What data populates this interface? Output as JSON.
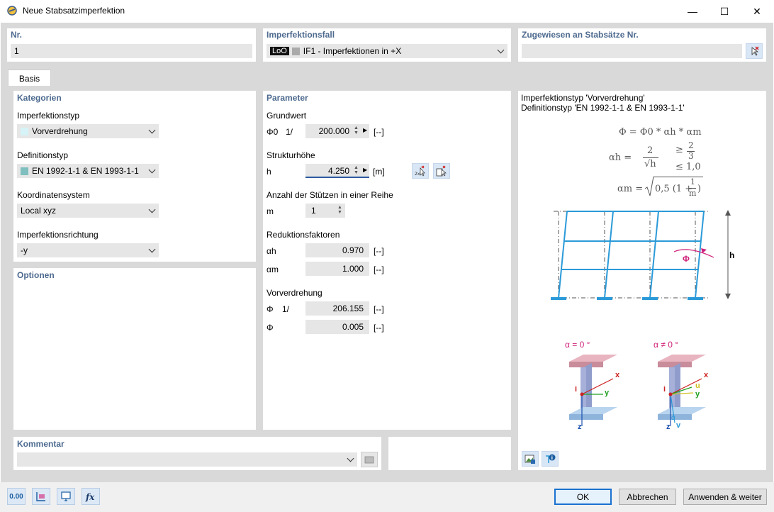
{
  "window": {
    "title": "Neue Stabsatzimperfektion",
    "minimize": "—",
    "maximize": "☐",
    "close": "✕"
  },
  "header": {
    "nr_label": "Nr.",
    "nr_value": "1",
    "case_label": "Imperfektionsfall",
    "case_badge": "LoO",
    "case_value": "IF1 - Imperfektionen in +X",
    "assigned_label": "Zugewiesen an Stabsätze Nr.",
    "assigned_value": ""
  },
  "tabs": [
    {
      "label": "Basis"
    }
  ],
  "categories": {
    "title": "Kategorien",
    "imperfection_type_label": "Imperfektionstyp",
    "imperfection_type_value": "Vorverdrehung",
    "imperfection_type_color": "#d6f3f7",
    "definition_type_label": "Definitionstyp",
    "definition_type_value": "EN 1992-1-1 & EN 1993-1-1",
    "definition_type_color": "#7fbfbf",
    "coord_label": "Koordinatensystem",
    "coord_value": "Local xyz",
    "direction_label": "Imperfektionsrichtung",
    "direction_value": "-y"
  },
  "options": {
    "title": "Optionen"
  },
  "parameter": {
    "title": "Parameter",
    "grundwert_label": "Grundwert",
    "phi0_symbol": "Φ0",
    "phi0_prefix": "1/",
    "phi0_value": "200.000",
    "phi0_unit": "[--]",
    "struktur_label": "Strukturhöhe",
    "h_symbol": "h",
    "h_value": "4.250",
    "h_unit": "[m]",
    "stuetzen_label": "Anzahl der Stützen in einer Reihe",
    "m_symbol": "m",
    "m_value": "1",
    "reduktion_label": "Reduktionsfaktoren",
    "ah_symbol": "αh",
    "ah_value": "0.970",
    "ah_unit": "[--]",
    "am_symbol": "αm",
    "am_value": "1.000",
    "am_unit": "[--]",
    "vorverdrehung_label": "Vorverdrehung",
    "phi_symbol": "Φ",
    "phi_prefix": "1/",
    "phi_inv_value": "206.155",
    "phi_inv_unit": "[--]",
    "phi2_symbol": "Φ",
    "phi_value": "0.005",
    "phi_unit": "[--]"
  },
  "info": {
    "line1": "Imperfektionstyp 'Vorverdrehung'",
    "line2": "Definitionstyp 'EN 1992-1-1 & EN 1993-1-1'",
    "f1": "Φ = Φ0 * αh * αm",
    "f2_lhs": "αh =",
    "f2_num": "2",
    "f2_den": "√h",
    "f2_ge": "≥",
    "f2_ge_num": "2",
    "f2_ge_den": "3",
    "f2_le": "≤ 1,0",
    "f3_lhs": "αm =",
    "f3_rhs": "0,5 (1 +",
    "f3_frac_num": "1",
    "f3_frac_den": "m",
    "f3_close": ")",
    "frame_h": "h",
    "frame_phi": "Φ",
    "alpha0": "α = 0 °",
    "alpha_ne0": "α ≠ 0 °",
    "axis_x": "x",
    "axis_y": "y",
    "axis_z": "z",
    "axis_i": "i",
    "axis_u": "u",
    "axis_v": "v",
    "axis_alpha": "α"
  },
  "comment": {
    "title": "Kommentar",
    "value": ""
  },
  "footer": {
    "icon1": "0.00",
    "ok": "OK",
    "cancel": "Abbrechen",
    "apply": "Anwenden & weiter"
  }
}
